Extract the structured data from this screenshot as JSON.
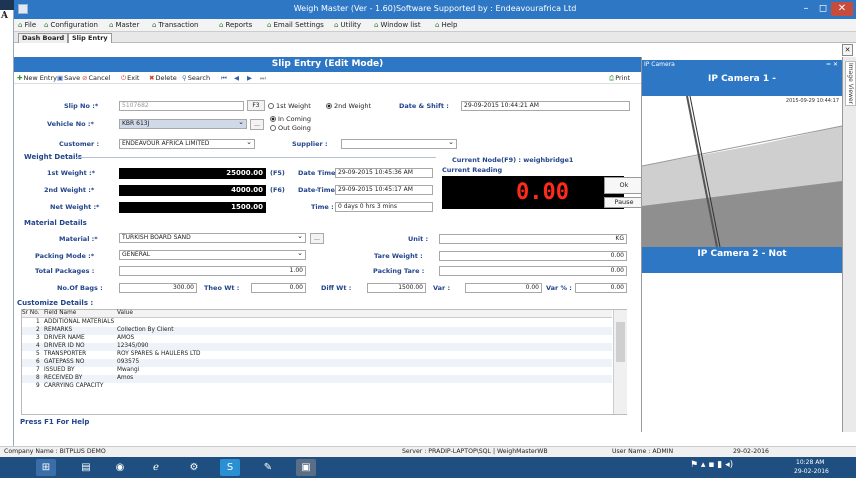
{
  "window": {
    "title": "Weigh Master (Ver - 1.60)Software Supported by : Endeavourafrica Ltd",
    "minimize": "–",
    "restore": "◻",
    "close": "✕"
  },
  "bg_mark": "A",
  "menu": [
    {
      "label": "File"
    },
    {
      "label": "Configuration"
    },
    {
      "label": "Master"
    },
    {
      "label": "Transaction"
    },
    {
      "label": "Reports"
    },
    {
      "label": "Email Settings"
    },
    {
      "label": "Utility"
    },
    {
      "label": "Window list"
    },
    {
      "label": "Help"
    }
  ],
  "tabs": [
    {
      "label": "Dash Board"
    },
    {
      "label": "Slip Entry"
    }
  ],
  "tab_close": "✕",
  "form": {
    "header": "Slip Entry (Edit Mode)",
    "toolbar": {
      "new_entry": "New Entry",
      "save": "Save",
      "cancel": "Cancel",
      "exit": "Exit",
      "delete": "Delete",
      "search": "Search",
      "print": "Print"
    },
    "slip_no": {
      "label": "Slip No :*",
      "value": "5107682",
      "btn": "F3"
    },
    "weight_mode": {
      "first": "1st Weight",
      "second": "2nd Weight",
      "selected": "2nd Weight"
    },
    "date_shift": {
      "label": "Date & Shift :",
      "value": "29-09-2015 10:44:21 AM"
    },
    "vehicle_no": {
      "label": "Vehicle No :*",
      "value": "KBR 613J",
      "btn": "..."
    },
    "direction": {
      "in": "In Coming",
      "out": "Out Going",
      "selected": "In Coming"
    },
    "customer": {
      "label": "Customer :",
      "value": "ENDEAVOUR AFRICA LIMITED"
    },
    "supplier": {
      "label": "Supplier :",
      "value": ""
    },
    "weight_details": {
      "title": "Weight Details",
      "first_label": "1st Weight :*",
      "first_value": "25000.00",
      "first_key": "(F5)",
      "second_label": "2nd Weight :*",
      "second_value": "4000.00",
      "second_key": "(F6)",
      "net_label": "Net Weight :*",
      "net_value": "1500.00",
      "dt1_label": "Date Time :",
      "dt1_value": "29-09-2015 10:45:36 AM",
      "dt2_label": "Date-Time :",
      "dt2_value": "29-09-2015 10:45:17 AM",
      "time_label": "Time :",
      "time_value": "0 days 0 hrs 3 mins"
    },
    "current_node": "Current Node(F9) : weighbridge1",
    "current_reading_label": "Current Reading",
    "reading": "0.00",
    "ok_btn": "Ok",
    "pause_btn": "Pause",
    "material": {
      "title": "Material Details",
      "material_label": "Material :*",
      "material_value": "TURKISH BOARD SAND",
      "material_btn": "...",
      "unit_label": "Unit :",
      "unit_value": "KG",
      "packing_label": "Packing Mode :*",
      "packing_value": "GENERAL",
      "tare_label": "Tare Weight :",
      "tare_value": "0.00",
      "total_label": "Total Packages :",
      "total_value": "1.00",
      "ptare_label": "Packing Tare :",
      "ptare_value": "0.00",
      "bags_label": "No.Of Bags :",
      "bags_value": "300.00",
      "theo_label": "Theo Wt :",
      "theo_value": "0.00",
      "diff_label": "Diff Wt :",
      "diff_value": "1500.00",
      "var_label": "Var :",
      "var_value": "0.00",
      "varp_label": "Var % :",
      "varp_value": "0.00"
    },
    "custom": {
      "title": "Customize Details :",
      "headers": [
        "Sr No.",
        "Field Name",
        "Value"
      ],
      "rows": [
        {
          "sr": "1",
          "name": "ADDITIONAL MATERIALS",
          "value": ""
        },
        {
          "sr": "2",
          "name": "REMARKS",
          "value": "Collection By Client"
        },
        {
          "sr": "3",
          "name": "DRIVER NAME",
          "value": "AMOS"
        },
        {
          "sr": "4",
          "name": "DRIVER ID NO",
          "value": "12345/090"
        },
        {
          "sr": "5",
          "name": "TRANSPORTER",
          "value": "ROY SPARES & HAULERS LTD"
        },
        {
          "sr": "6",
          "name": "GATEPASS NO",
          "value": "093575"
        },
        {
          "sr": "7",
          "name": "ISSUED BY",
          "value": "Mwangi"
        },
        {
          "sr": "8",
          "name": "RECEIVED BY",
          "value": "Amos"
        },
        {
          "sr": "9",
          "name": "CARRYING CAPACITY",
          "value": ""
        }
      ]
    },
    "help": "Press F1 For Help"
  },
  "camera": {
    "panel_title": "IP Camera",
    "cam1": "IP Camera 1 -",
    "cam2": "IP Camera 2 - Not",
    "stamp": "2015-09-29 10:44:17",
    "panel_ctrl": "= ✕"
  },
  "side_tab": "Image Viewer",
  "status": {
    "company": "Company Name : BITPLUS DEMO",
    "server": "Server : PRADIP-LAPTOP\\SQL | WeighMasterWB",
    "user": "User Name : ADMIN",
    "date": "29-02-2016"
  },
  "tray": {
    "time": "10:28 AM",
    "date": "29-02-2016"
  }
}
